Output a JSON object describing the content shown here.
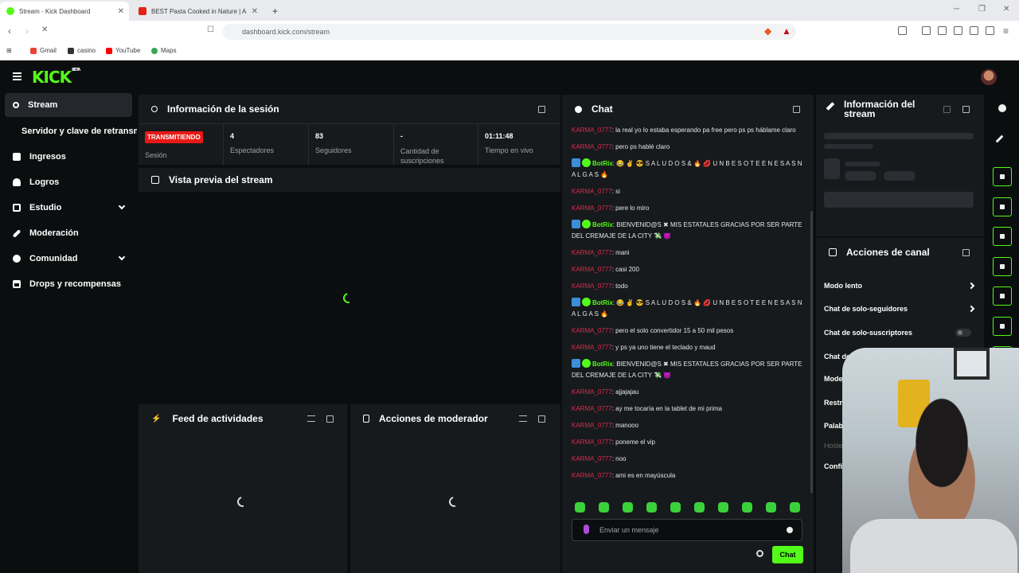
{
  "browser": {
    "tabs": [
      {
        "title": "Stream - Kick Dashboard",
        "active": true
      },
      {
        "title": "BEST Pasta Cooked in Nature | A",
        "active": false
      }
    ],
    "url": "dashboard.kick.com/stream",
    "bookmarks": [
      "Gmail",
      "casino",
      "YouTube",
      "Maps"
    ]
  },
  "app": {
    "logo": "KICK",
    "logo_badge": "BETA"
  },
  "sidebar": {
    "items": [
      {
        "label": "Stream"
      },
      {
        "label": "Servidor y clave de retransmisión"
      },
      {
        "label": "Ingresos"
      },
      {
        "label": "Logros"
      },
      {
        "label": "Estudio"
      },
      {
        "label": "Moderación"
      },
      {
        "label": "Comunidad"
      },
      {
        "label": "Drops y recompensas"
      }
    ]
  },
  "session": {
    "title": "Información de la sesión",
    "badge": "TRANSMITIENDO",
    "stats": [
      {
        "value": "",
        "label": "Sesión"
      },
      {
        "value": "4",
        "label": "Espectadores"
      },
      {
        "value": "83",
        "label": "Seguidores"
      },
      {
        "value": "-",
        "label": "Cantidad de suscripciones"
      },
      {
        "value": "01:11:48",
        "label": "Tiempo en vivo"
      }
    ]
  },
  "preview": {
    "title": "Vista previa del stream"
  },
  "feed": {
    "title": "Feed de actividades"
  },
  "modactions": {
    "title": "Acciones de moderador"
  },
  "chat": {
    "title": "Chat",
    "messages": [
      {
        "user": "KARMA_0777",
        "text": ": la real yo lo estaba esperando pa free pero ps ps háblame claro"
      },
      {
        "user": "KARMA_0777",
        "text": ": pero ps hablé claro"
      },
      {
        "user": "BotRix",
        "text": ": 😂 ✌ 😎 S A L U D O S & 🔥 💋 U N  B E S O T E  E N  E S A S  N A L G A S 🔥",
        "bot": true
      },
      {
        "user": "KARMA_0777",
        "text": ": si"
      },
      {
        "user": "KARMA_0777",
        "text": ": pere lo miro"
      },
      {
        "user": "BotRix",
        "text": ": BIENVENID@S ✖ MIS ESTATALES GRACIAS POR SER PARTE DEL CREMAJE DE LA CITY 💸 😈",
        "bot": true
      },
      {
        "user": "KARMA_0777",
        "text": ": mani"
      },
      {
        "user": "KARMA_0777",
        "text": ": casi 200"
      },
      {
        "user": "KARMA_0777",
        "text": ": todo"
      },
      {
        "user": "BotRix",
        "text": ": 😂 ✌ 😎 S A L U D O S & 🔥 💋 U N  B E S O T E  E N  E S A S  N A L G A S 🔥",
        "bot": true
      },
      {
        "user": "KARMA_0777",
        "text": ": pero el solo convertidor 15 a 50 mil pesos"
      },
      {
        "user": "KARMA_0777",
        "text": ": y ps ya uno tiene el teclado y maud"
      },
      {
        "user": "BotRix",
        "text": ": BIENVENID@S ✖ MIS ESTATALES GRACIAS POR SER PARTE DEL CREMAJE DE LA CITY 💸 😈",
        "bot": true
      },
      {
        "user": "KARMA_0777",
        "text": ": ajjajajau"
      },
      {
        "user": "KARMA_0777",
        "text": ": ay me tocaría en la tablet de mi prima"
      },
      {
        "user": "KARMA_0777",
        "text": ": manooo"
      },
      {
        "user": "KARMA_0777",
        "text": ": poneme el vip"
      },
      {
        "user": "KARMA_0777",
        "text": ": noo"
      },
      {
        "user": "KARMA_0777",
        "text": ": ami es en mayúscula"
      }
    ],
    "input_placeholder": "Enviar un mensaje",
    "send_label": "Chat"
  },
  "stream_info": {
    "title_line1": "Información del",
    "title_line2": "stream"
  },
  "canal": {
    "title": "Acciones de canal",
    "rows": [
      {
        "label": "Modo lento"
      },
      {
        "label": "Chat de solo-seguidores"
      },
      {
        "label": "Chat de solo-suscriptores"
      },
      {
        "label": "Chat de"
      },
      {
        "label": "Mode"
      },
      {
        "label": "Restr"
      },
      {
        "label": "Palab"
      },
      {
        "label": "Hoste"
      },
      {
        "label": "Confi"
      }
    ]
  },
  "colors": {
    "accent": "#53fc18",
    "live": "#e91916",
    "username": "#d22f4f",
    "panel": "#171a1c",
    "bg": "#0b0e0f"
  }
}
